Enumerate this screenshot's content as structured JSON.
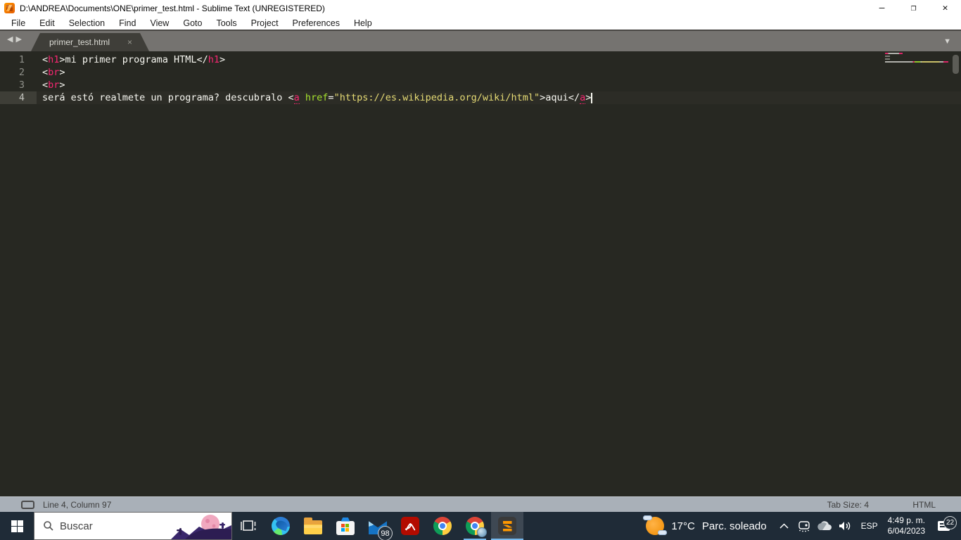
{
  "window": {
    "title": "D:\\ANDREA\\Documents\\ONE\\primer_test.html - Sublime Text (UNREGISTERED)",
    "minimize": "–",
    "restore": "❐",
    "close": "✕"
  },
  "menu": {
    "items": [
      "File",
      "Edit",
      "Selection",
      "Find",
      "View",
      "Goto",
      "Tools",
      "Project",
      "Preferences",
      "Help"
    ]
  },
  "tabbar": {
    "active_tab": "primer_test.html",
    "close": "×",
    "prev": "◀",
    "next": "▶",
    "overflow": "▼"
  },
  "editor": {
    "lines": [
      {
        "num": "1",
        "current": false,
        "tokens": [
          [
            "p",
            "<"
          ],
          [
            "t",
            "h1"
          ],
          [
            "p",
            ">mi primer programa HTML</"
          ],
          [
            "t",
            "h1"
          ],
          [
            "p",
            ">"
          ]
        ]
      },
      {
        "num": "2",
        "current": false,
        "tokens": [
          [
            "p",
            "<"
          ],
          [
            "t",
            "br"
          ],
          [
            "p",
            ">"
          ]
        ]
      },
      {
        "num": "3",
        "current": false,
        "tokens": [
          [
            "p",
            "<"
          ],
          [
            "t",
            "br"
          ],
          [
            "p",
            ">"
          ]
        ]
      },
      {
        "num": "4",
        "current": true,
        "tokens": [
          [
            "p",
            "será estó realmete un programa? descubralo <"
          ],
          [
            "tu",
            "a"
          ],
          [
            "p",
            " "
          ],
          [
            "a",
            "href"
          ],
          [
            "p",
            "="
          ],
          [
            "s",
            "\"https://es.wikipedia.org/wiki/html\""
          ],
          [
            "p",
            ">aqui</"
          ],
          [
            "tu",
            "a"
          ],
          [
            "p",
            ">"
          ]
        ],
        "caret": true
      }
    ],
    "colors": {
      "background": "#272822",
      "plain": "#f8f8f2",
      "tag": "#f92672",
      "attribute": "#a6e22e",
      "string": "#e6db74",
      "gutter": "#8f908a"
    }
  },
  "statusbar": {
    "position": "Line 4, Column 97",
    "tab_size": "Tab Size: 4",
    "syntax": "HTML"
  },
  "taskbar": {
    "search_placeholder": "Buscar",
    "mail_badge": "98",
    "tray": {
      "temperature": "17°C",
      "condition": "Parc. soleado",
      "language": "ESP",
      "time": "4:49 p. m.",
      "date": "6/04/2023",
      "notification_badge": "22"
    },
    "colors": {
      "taskbar_bg": "#1f2b37",
      "running_indicator": "#76b9ed"
    }
  }
}
